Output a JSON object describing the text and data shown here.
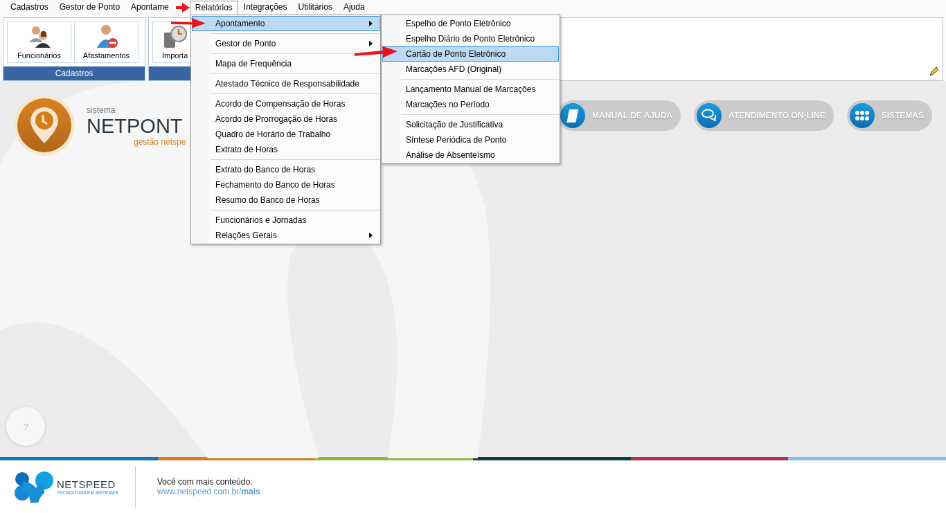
{
  "menu_bar": [
    {
      "label": "Cadastros",
      "selected": false
    },
    {
      "label": "Gestor de Ponto",
      "selected": false
    },
    {
      "label": "Apontame",
      "selected": false
    },
    {
      "label": "Relatórios",
      "selected": true
    },
    {
      "label": "Integrações",
      "selected": false
    },
    {
      "label": "Utilitários",
      "selected": false
    },
    {
      "label": "Ajuda",
      "selected": false
    }
  ],
  "ribbon": {
    "groups": [
      {
        "title": "Cadastros",
        "buttons": [
          {
            "label": "Funcionários"
          },
          {
            "label": "Afastamentos"
          }
        ]
      },
      {
        "buttons": [
          {
            "label": "Importa"
          }
        ]
      }
    ]
  },
  "logo": {
    "caption": "sistema",
    "name": "NETPONT",
    "tagline": "gestão netspe"
  },
  "quick_links": [
    {
      "label": "MANUAL DE AJUDA"
    },
    {
      "label": "ATENDIMENTO ON-LINE"
    },
    {
      "label": "SISTEMAS"
    }
  ],
  "help_button": {
    "label": "?"
  },
  "footer": {
    "brand": "NETSPEED",
    "brand_tagline": "TECNOLOGIA EM SISTEMAS",
    "message": "Você com mais conteúdo.",
    "link": "www.netspeed.com.br/**mais**"
  },
  "menus": [
    {
      "groups": [
        [
          {
            "label": "Apontamento",
            "selected": true,
            "submenu": true
          }
        ],
        [
          {
            "label": "Gestor de Ponto",
            "selected": false,
            "submenu": true
          }
        ],
        [
          {
            "label": "Mapa de Frequência",
            "selected": false,
            "submenu": false
          }
        ],
        [
          {
            "label": "Atestado Técnico de Responsabilidade",
            "selected": false,
            "submenu": false
          }
        ],
        [
          {
            "label": "Acordo de Compensação de Horas",
            "selected": false,
            "submenu": false
          },
          {
            "label": "Acordo de Prorrogação de Horas",
            "selected": false,
            "submenu": false
          },
          {
            "label": "Quadro de Horário de Trabalho",
            "selected": false,
            "submenu": false
          },
          {
            "label": "Extrato de Horas",
            "selected": false,
            "submenu": false
          }
        ],
        [
          {
            "label": "Extrato do Banco de Horas",
            "selected": false,
            "submenu": false
          },
          {
            "label": "Fechamento do Banco de Horas",
            "selected": false,
            "submenu": false
          },
          {
            "label": "Resumo do Banco de Horas",
            "selected": false,
            "submenu": false
          }
        ],
        [
          {
            "label": "Funcionários e Jornadas",
            "selected": false,
            "submenu": false
          },
          {
            "label": "Relações Gerais",
            "selected": false,
            "submenu": true
          }
        ]
      ]
    },
    {
      "groups": [
        [
          {
            "label": "Espelho de Ponto Eletrônico",
            "selected": false,
            "submenu": false
          },
          {
            "label": "Espelho Diário de Ponto Eletrônico",
            "selected": false,
            "submenu": false
          },
          {
            "label": "Cartão de Ponto Eletrônico",
            "selected": true,
            "submenu": false
          },
          {
            "label": "Marcações AFD (Original)",
            "selected": false,
            "submenu": false
          }
        ],
        [
          {
            "label": "Lançamento Manual de Marcações",
            "selected": false,
            "submenu": false
          },
          {
            "label": "Marcações no Período",
            "selected": false,
            "submenu": false
          }
        ],
        [
          {
            "label": "Solicitação de Justificativa",
            "selected": false,
            "submenu": false
          },
          {
            "label": "Síntese Periódica de Ponto",
            "selected": false,
            "submenu": false
          },
          {
            "label": "Análise de Absenteísmo",
            "selected": false,
            "submenu": false
          }
        ]
      ]
    }
  ]
}
